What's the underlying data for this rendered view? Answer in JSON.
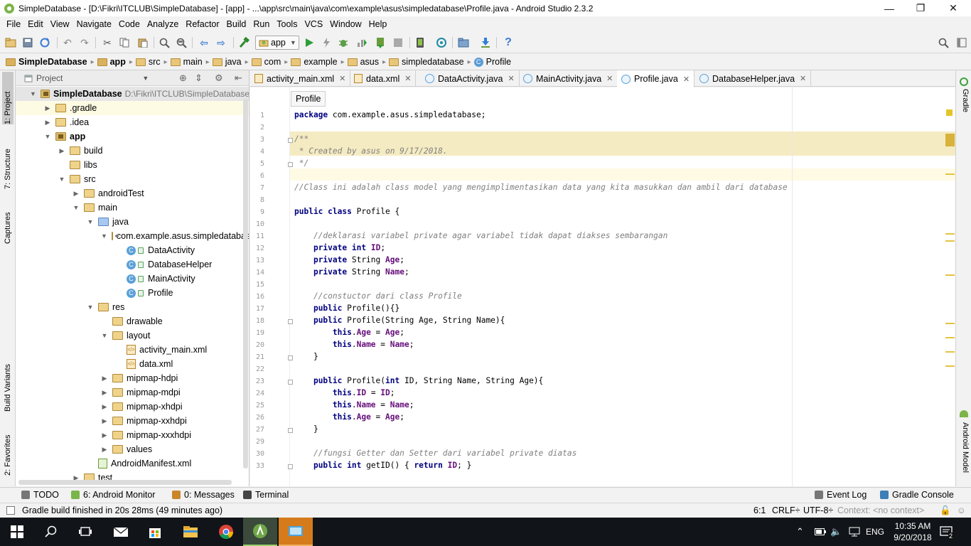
{
  "window": {
    "title": "SimpleDatabase - [D:\\Fikri\\ITCLUB\\SimpleDatabase] - [app] - ...\\app\\src\\main\\java\\com\\example\\asus\\simpledatabase\\Profile.java - Android Studio 2.3.2",
    "controls": [
      "—",
      "❐",
      "✕"
    ]
  },
  "menu": [
    "File",
    "Edit",
    "View",
    "Navigate",
    "Code",
    "Analyze",
    "Refactor",
    "Build",
    "Run",
    "Tools",
    "VCS",
    "Window",
    "Help"
  ],
  "menu_mnemonic": [
    "F",
    "E",
    "V",
    "N",
    "C",
    "z",
    "R",
    "B",
    "u",
    "T",
    "S",
    "W",
    "H"
  ],
  "toolbar": {
    "run_config": "app",
    "icons": [
      "open-icon",
      "save-icon",
      "sync-icon",
      "undo-icon",
      "redo-icon",
      "cut-icon",
      "copy-icon",
      "paste-icon",
      "find-icon",
      "replace-icon",
      "back-icon",
      "forward-icon",
      "make-icon",
      "run-icon",
      "apply-changes-icon",
      "debug-icon",
      "profile-icon",
      "attach-icon",
      "stop-icon",
      "avd-icon",
      "gradle-sync-icon",
      "project-structure-icon",
      "sdk-manager-icon",
      "help-icon",
      "search-everywhere-icon",
      "layout-icon"
    ]
  },
  "breadcrumb": [
    "SimpleDatabase",
    "app",
    "src",
    "main",
    "java",
    "com",
    "example",
    "asus",
    "simpledatabase",
    "Profile"
  ],
  "left_tabs": [
    "1: Project",
    "7: Structure",
    "Captures",
    "Build Variants",
    "2: Favorites"
  ],
  "right_tabs": [
    "Gradle",
    "Android Model"
  ],
  "project_panel": {
    "view": "Project",
    "tree": [
      {
        "label": "SimpleDatabase",
        "path": "D:\\Fikri\\ITCLUB\\SimpleDatabase",
        "depth": 0,
        "open": true,
        "icon": "module",
        "bold": true
      },
      {
        "label": ".gradle",
        "depth": 1,
        "open": false,
        "icon": "folder"
      },
      {
        "label": ".idea",
        "depth": 1,
        "open": false,
        "icon": "folder"
      },
      {
        "label": "app",
        "depth": 1,
        "open": true,
        "icon": "module",
        "bold": true
      },
      {
        "label": "build",
        "depth": 2,
        "open": false,
        "icon": "folder"
      },
      {
        "label": "libs",
        "depth": 2,
        "icon": "folder"
      },
      {
        "label": "src",
        "depth": 2,
        "open": true,
        "icon": "folder"
      },
      {
        "label": "androidTest",
        "depth": 3,
        "open": false,
        "icon": "folder"
      },
      {
        "label": "main",
        "depth": 3,
        "open": true,
        "icon": "folder"
      },
      {
        "label": "java",
        "depth": 4,
        "open": true,
        "icon": "java"
      },
      {
        "label": "com.example.asus.simpledatabase",
        "depth": 5,
        "open": true,
        "icon": "package"
      },
      {
        "label": "DataActivity",
        "depth": 6,
        "icon": "class"
      },
      {
        "label": "DatabaseHelper",
        "depth": 6,
        "icon": "class"
      },
      {
        "label": "MainActivity",
        "depth": 6,
        "icon": "class"
      },
      {
        "label": "Profile",
        "depth": 6,
        "icon": "class"
      },
      {
        "label": "res",
        "depth": 4,
        "open": true,
        "icon": "res"
      },
      {
        "label": "drawable",
        "depth": 5,
        "icon": "folder"
      },
      {
        "label": "layout",
        "depth": 5,
        "open": true,
        "icon": "folder"
      },
      {
        "label": "activity_main.xml",
        "depth": 6,
        "icon": "xml"
      },
      {
        "label": "data.xml",
        "depth": 6,
        "icon": "xml"
      },
      {
        "label": "mipmap-hdpi",
        "depth": 5,
        "open": false,
        "icon": "folder"
      },
      {
        "label": "mipmap-mdpi",
        "depth": 5,
        "open": false,
        "icon": "folder"
      },
      {
        "label": "mipmap-xhdpi",
        "depth": 5,
        "open": false,
        "icon": "folder"
      },
      {
        "label": "mipmap-xxhdpi",
        "depth": 5,
        "open": false,
        "icon": "folder"
      },
      {
        "label": "mipmap-xxxhdpi",
        "depth": 5,
        "open": false,
        "icon": "folder"
      },
      {
        "label": "values",
        "depth": 5,
        "open": false,
        "icon": "folder"
      },
      {
        "label": "AndroidManifest.xml",
        "depth": 4,
        "icon": "manifest"
      },
      {
        "label": "test",
        "depth": 3,
        "open": false,
        "icon": "folder"
      }
    ]
  },
  "editor_tabs": [
    {
      "label": "activity_main.xml",
      "type": "xml"
    },
    {
      "label": "data.xml",
      "type": "xml"
    },
    {
      "label": "DataActivity.java",
      "type": "class"
    },
    {
      "label": "MainActivity.java",
      "type": "class"
    },
    {
      "label": "Profile.java",
      "type": "class",
      "active": true
    },
    {
      "label": "DatabaseHelper.java",
      "type": "class"
    }
  ],
  "tooltip": "Profile",
  "code_lines": [
    "package com.example.asus.simpledatabase;",
    "",
    "/**",
    " * Created by asus on 9/17/2018.",
    " */",
    "",
    "//Class ini adalah class model yang mengimplimentasikan data yang kita masukkan dan ambil dari database",
    "",
    "public class Profile {",
    "",
    "    //deklarasi variabel private agar variabel tidak dapat diakses sembarangan",
    "    private int ID;",
    "    private String Age;",
    "    private String Name;",
    "",
    "    //constuctor dari class Profile",
    "    public Profile(){}",
    "    public Profile(String Age, String Name){",
    "        this.Age = Age;",
    "        this.Name = Name;",
    "    }",
    "",
    "    public Profile(int ID, String Name, String Age){",
    "        this.ID = ID;",
    "        this.Name = Name;",
    "        this.Age = Age;",
    "    }",
    "",
    "    //fungsi Getter dan Setter dari variabel private diatas",
    "    public int getID() { return ID; }",
    "",
    ""
  ],
  "line_numbers": [
    "1",
    "2",
    "3",
    "4",
    "5",
    "6",
    "7",
    "8",
    "9",
    "10",
    "11",
    "12",
    "13",
    "14",
    "15",
    "16",
    "17",
    "18",
    "19",
    "20",
    "21",
    "22",
    "23",
    "24",
    "25",
    "26",
    "27",
    "29",
    "30",
    "33"
  ],
  "tool_windows": [
    {
      "label": "TODO",
      "icon": "todo-icon"
    },
    {
      "label": "6: Android Monitor",
      "icon": "android-monitor-icon"
    },
    {
      "label": "0: Messages",
      "icon": "messages-icon"
    },
    {
      "label": "Terminal",
      "icon": "terminal-icon"
    },
    {
      "label": "Event Log",
      "icon": "event-log-icon"
    },
    {
      "label": "Gradle Console",
      "icon": "gradle-console-icon"
    }
  ],
  "status": {
    "message": "Gradle build finished in 20s 28ms (49 minutes ago)",
    "position": "6:1",
    "line_sep": "CRLF÷",
    "encoding": "UTF-8÷",
    "context": "Context: <no context>"
  },
  "taskbar": {
    "time": "10:35 AM",
    "date": "9/20/2018",
    "lang": "ENG",
    "notifications": "2"
  }
}
